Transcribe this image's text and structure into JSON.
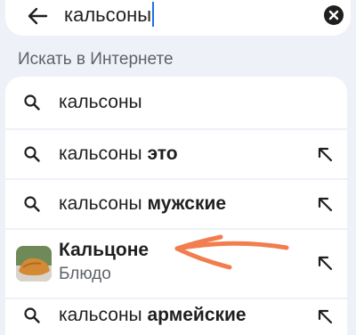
{
  "search": {
    "query": "кальсоны"
  },
  "section_label": "Искать в Интернете",
  "suggestions": [
    {
      "plain": "кальсоны",
      "bold": ""
    },
    {
      "plain": "кальсоны ",
      "bold": "это"
    },
    {
      "plain": "кальсоны ",
      "bold": "мужские"
    },
    {
      "plain": "кальсоны ",
      "bold": "армейские"
    }
  ],
  "entity": {
    "title": "Кальцоне",
    "subtitle": "Блюдо"
  },
  "icons": {
    "back": "arrow-back-icon",
    "clear": "clear-circle-icon",
    "search": "search-icon",
    "fill_query": "arrow-up-left-icon",
    "annotation": "hand-drawn-arrow"
  },
  "colors": {
    "background": "#eef1f7",
    "surface": "#ffffff",
    "caret": "#1a73e8",
    "annotation": "#f27d4e",
    "secondary_text": "#5f6368"
  }
}
